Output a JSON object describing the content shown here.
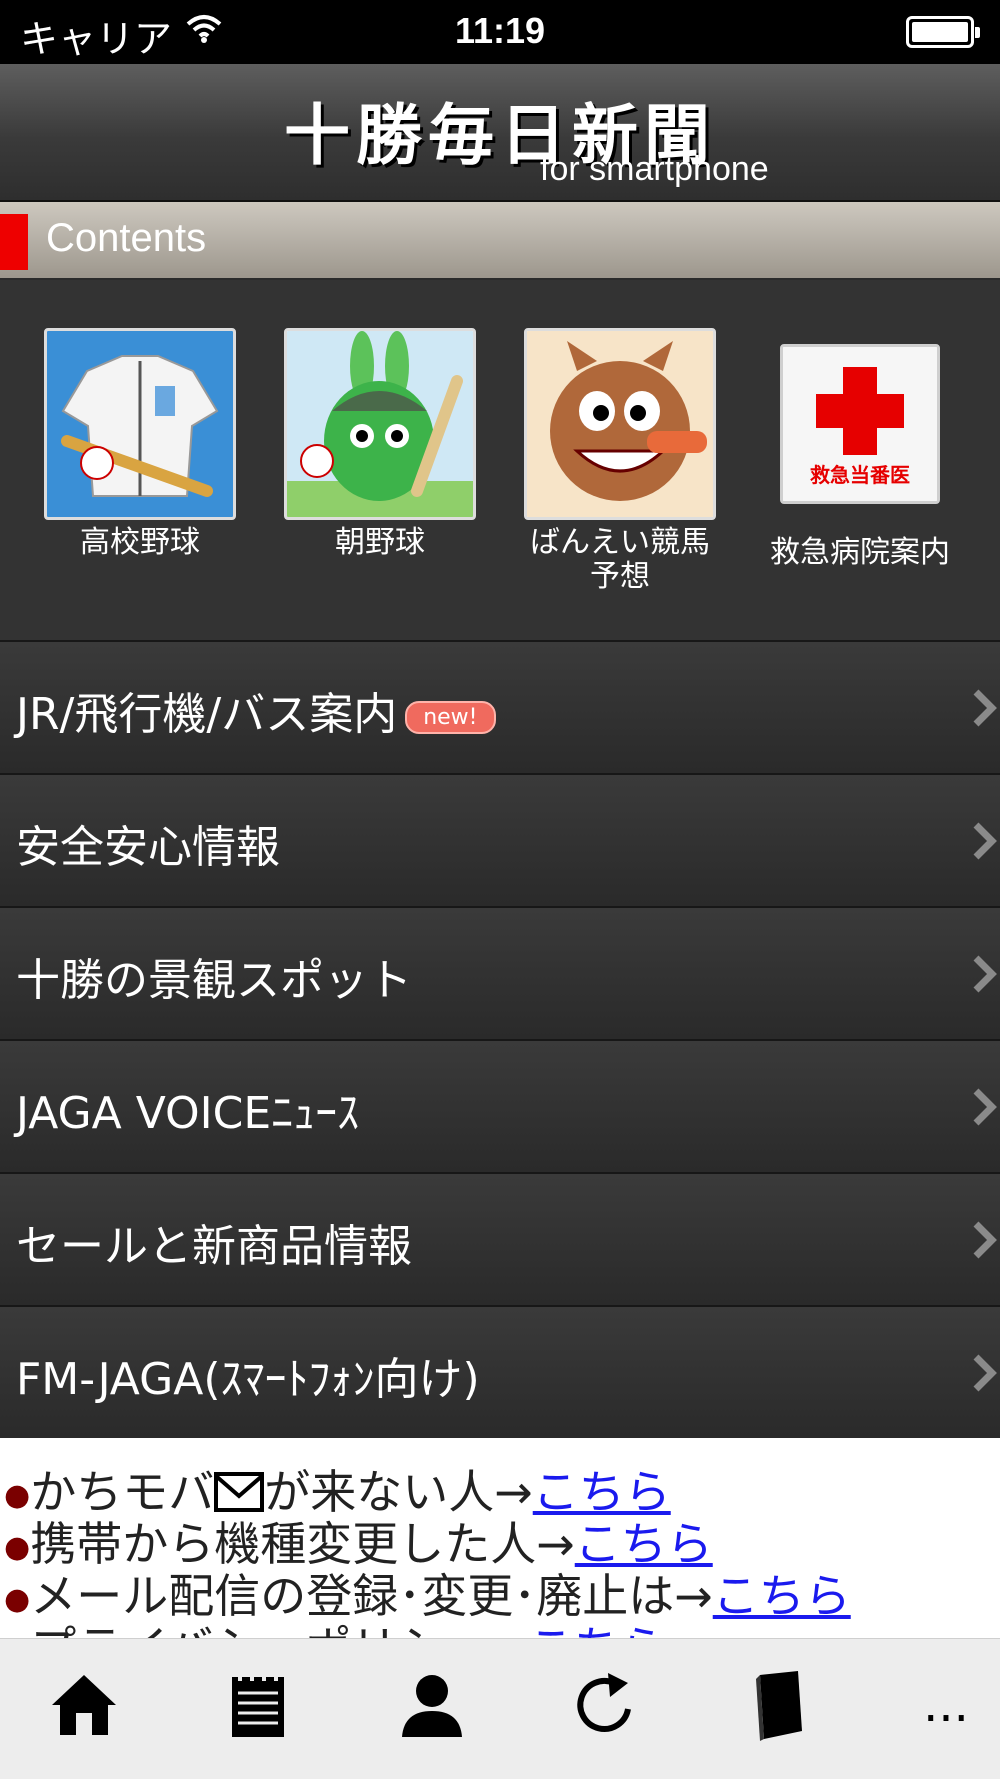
{
  "status_bar": {
    "carrier": "キャリア",
    "time": "11:19"
  },
  "header": {
    "logo_text": "十勝毎日新聞",
    "logo_subtitle": "for smartphone"
  },
  "section": {
    "title": "Contents"
  },
  "tiles": [
    {
      "label": "高校野球"
    },
    {
      "label": "朝野球"
    },
    {
      "label": "ばんえい競馬予想",
      "line1": "ばんえい競馬",
      "line2": "予想"
    },
    {
      "label": "救急病院案内",
      "icon_text": "救急当番医"
    }
  ],
  "menu": [
    {
      "label": "JR/飛行機/バス案内",
      "badge": "new!"
    },
    {
      "label": "安全安心情報"
    },
    {
      "label": "十勝の景観スポット"
    },
    {
      "label": "JAGA VOICEﾆｭｰｽ"
    },
    {
      "label": "セールと新商品情報"
    },
    {
      "label": "FM-JAGA(ｽﾏｰﾄﾌｫﾝ向け)"
    }
  ],
  "notices": [
    {
      "text": "かちモバ",
      "text_after_icon": "が来ない人→",
      "link": "こちら"
    },
    {
      "text": "携帯から機種変更した人→",
      "link": "こちら"
    },
    {
      "text": "メール配信の登録･変更･廃止は→",
      "link": "こちら"
    },
    {
      "text": "プライバシーポリシー→",
      "link": "こちら"
    }
  ],
  "toolbar": {
    "more_label": "..."
  },
  "colors": {
    "accent_red": "#ee0000",
    "link_blue": "#1a1aee",
    "background": "#2b2b2b"
  }
}
